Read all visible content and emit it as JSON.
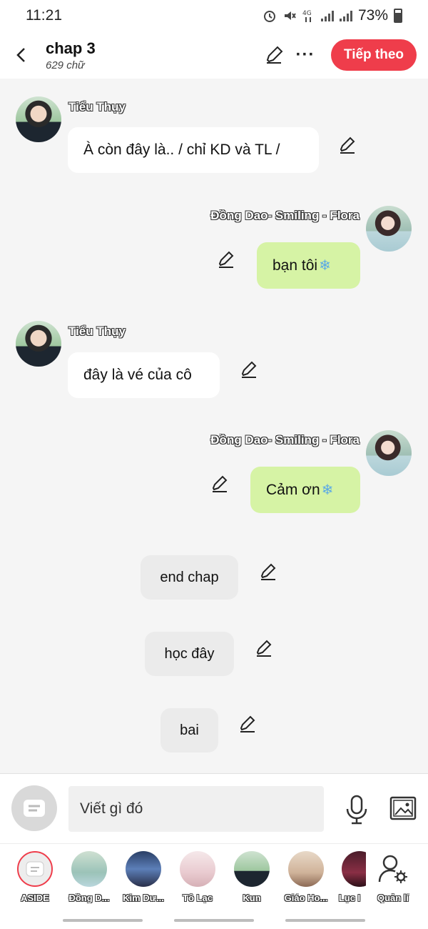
{
  "status": {
    "time": "11:21",
    "battery": "73%",
    "icons": [
      "alarm-icon",
      "mute-icon",
      "4g-icon",
      "signal-icon",
      "signal-icon",
      "battery-icon"
    ]
  },
  "header": {
    "title": "chap 3",
    "subtitle": "629 chữ",
    "next_label": "Tiếp theo"
  },
  "messages": [
    {
      "side": "left",
      "name": "Tiểu Thụy",
      "text": "À còn đây là.. / chỉ KD và TL /"
    },
    {
      "side": "right",
      "name": "Đồng Dao- Smiling - Flora",
      "text": "bạn tôi"
    },
    {
      "side": "left",
      "name": "Tiểu Thụy",
      "text": "đây là vé của cô"
    },
    {
      "side": "right",
      "name": "Đồng Dao- Smiling - Flora",
      "text": "Cảm ơn"
    },
    {
      "side": "aside",
      "text": "end chap"
    },
    {
      "side": "aside",
      "text": "học đây"
    },
    {
      "side": "aside",
      "text": "bai"
    }
  ],
  "composer": {
    "placeholder": "Viết gì đó"
  },
  "characters": [
    {
      "label": "ASIDE"
    },
    {
      "label": "Đồng D..."
    },
    {
      "label": "Kim Dư..."
    },
    {
      "label": "Tô Lạc"
    },
    {
      "label": "Kun"
    },
    {
      "label": "Giáo Ho..."
    },
    {
      "label": "Lục I"
    },
    {
      "label": "Quản lí"
    }
  ],
  "colors": {
    "accent": "#ef3d4b",
    "bubble_right": "#d6f3a5",
    "bubble_left": "#ffffff",
    "bubble_aside": "#ebebeb"
  }
}
